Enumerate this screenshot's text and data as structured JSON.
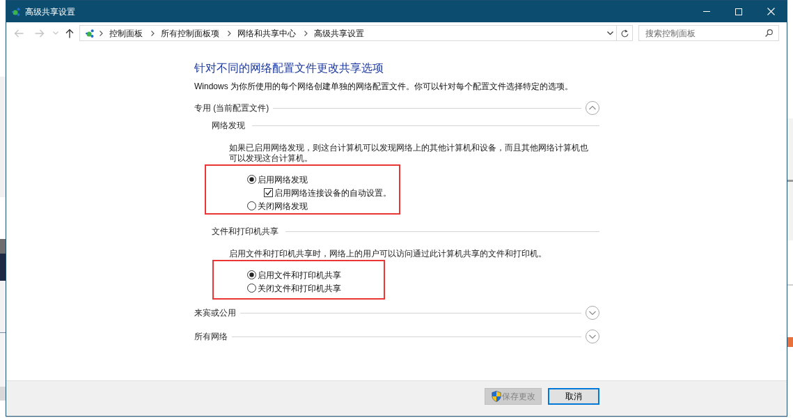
{
  "window": {
    "title": "高级共享设置"
  },
  "navigation": [
    {
      "kind": "back",
      "disabled": true
    },
    {
      "kind": "forward",
      "disabled": true
    },
    {
      "kind": "recent",
      "disabled": true
    },
    {
      "kind": "up",
      "disabled": false
    }
  ],
  "address_bar": {
    "breadcrumbs": [
      "控制面板",
      "所有控制面板项",
      "网络和共享中心",
      "高级共享设置"
    ]
  },
  "search": {
    "placeholder": "搜索控制面板"
  },
  "heading": "针对不同的网络配置文件更改共享选项",
  "intro": "Windows 为你所使用的每个网络创建单独的网络配置文件。你可以针对每个配置文件选择特定的选项。",
  "profiles": [
    {
      "title": "专用 (当前配置文件)",
      "expanded": true,
      "sections": [
        {
          "title": "网络发现",
          "description": "如果已启用网络发现，则这台计算机可以发现网络上的其他计算机和设备，而且其他网络计算机也可以发现这台计算机。",
          "highlighted": true,
          "options": [
            {
              "label": "启用网络发现",
              "selected": true,
              "children": [
                {
                  "label": "启用网络连接设备的自动设置。",
                  "checked": true
                }
              ]
            },
            {
              "label": "关闭网络发现",
              "selected": false
            }
          ]
        },
        {
          "title": "文件和打印机共享",
          "description": "启用文件和打印机共享时，网络上的用户可以访问通过此计算机共享的文件和打印机。",
          "highlighted": true,
          "options": [
            {
              "label": "启用文件和打印机共享",
              "selected": true
            },
            {
              "label": "关闭文件和打印机共享",
              "selected": false
            }
          ]
        }
      ]
    },
    {
      "title": "来宾或公用",
      "expanded": false
    },
    {
      "title": "所有网络",
      "expanded": false
    }
  ],
  "buttons": [
    {
      "label": "保存更改",
      "kind": "elevated",
      "disabled": true,
      "focused": false
    },
    {
      "label": "取消",
      "kind": "plain",
      "disabled": false,
      "focused": true
    }
  ]
}
